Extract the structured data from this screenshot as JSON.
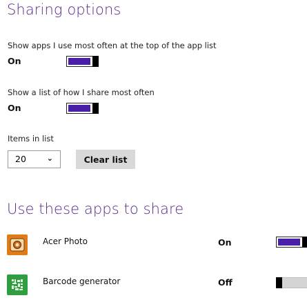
{
  "sharing": {
    "title": "Sharing options",
    "setting1": {
      "label": "Show apps I use most often at the top of the app list",
      "state": "On",
      "on": true
    },
    "setting2": {
      "label": "Show a list of how I share most often",
      "state": "On",
      "on": true
    },
    "items": {
      "label": "Items in list",
      "selected": "20",
      "chevron": "⌄",
      "clear_label": "Clear list"
    }
  },
  "apps": {
    "title": "Use these apps to share",
    "list": [
      {
        "name": "Acer Photo",
        "state": "On",
        "on": true,
        "icon": "acer-photo-icon",
        "color": "#e07b1a"
      },
      {
        "name": "Barcode generator",
        "state": "Off",
        "on": false,
        "icon": "barcode-generator-icon",
        "color": "#2e9e3e"
      }
    ]
  },
  "colors": {
    "heading": "#5b2a8a",
    "toggle_on": "#4a1fa8"
  }
}
